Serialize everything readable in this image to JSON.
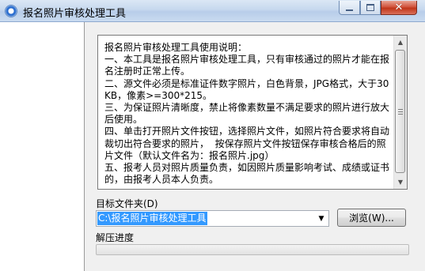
{
  "window": {
    "title": "报名照片审核处理工具",
    "buttons": {
      "minimize": "–",
      "maximize": "□",
      "close": "✕"
    }
  },
  "icons": {
    "app": "app-icon",
    "scroll_up": "up-arrow-icon",
    "scroll_down": "down-arrow-icon",
    "combo": "dropdown-arrow-icon"
  },
  "instructions": {
    "text": "报名照片审核处理工具使用说明：\n一、本工具是报名照片审核处理工具，只有审核通过的照片才能在报名注册时正常上传。\n二、源文件必须是标准证件数字照片，白色背景，JPG格式，大于30KB，像素>=300*215。\n三、为保证照片清晰度，禁止将像素数量不满足要求的照片进行放大后使用。\n四、单击打开照片文件按钮，选择照片文件，如照片符合要求将自动裁切出符合要求的照片，  按保存照片文件按钮保存审核合格后的照片文件（默认文件名为：报名照片.jpg）\n五、报考人员对照片质量负责，如因照片质量影响考试、成绩或证书的，由报考人员本人负责。",
    "scroll_up": "▲",
    "scroll_down": "▼"
  },
  "target": {
    "label": "目标文件夹(D)",
    "path": "C:\\报名照片审核处理工具",
    "dropdown_glyph": "▼",
    "browse_label": "浏览(W)..."
  },
  "progress": {
    "label": "解压进度",
    "value": 0
  },
  "colors": {
    "selection": "#3399ff",
    "progress": "#06b025",
    "close_button": "#c03519"
  }
}
